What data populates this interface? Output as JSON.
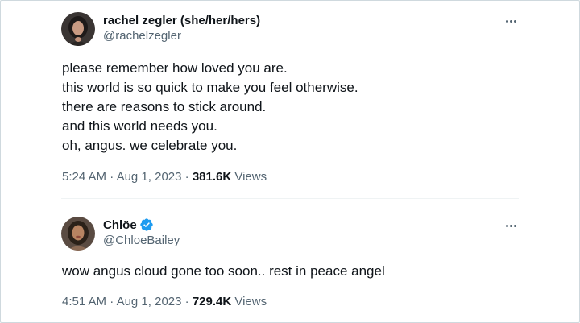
{
  "tweets": [
    {
      "display_name": "rachel zegler (she/her/hers)",
      "handle": "@rachelzegler",
      "verified": false,
      "lines": [
        "please remember how loved you are.",
        "this world is so quick to make you feel otherwise.",
        "there are reasons to stick around.",
        "and this world needs you.",
        "oh, angus. we celebrate you."
      ],
      "time": "5:24 AM",
      "date": "Aug 1, 2023",
      "views_count": "381.6K",
      "views_label": "Views"
    },
    {
      "display_name": "Chlöe",
      "handle": "@ChloeBailey",
      "verified": true,
      "lines": [
        "wow angus cloud gone too soon.. rest in peace angel"
      ],
      "time": "4:51 AM",
      "date": "Aug 1, 2023",
      "views_count": "729.4K",
      "views_label": "Views"
    }
  ],
  "separator": "·",
  "colors": {
    "text_primary": "#0f1419",
    "text_secondary": "#536471",
    "verified_blue": "#1d9bf0",
    "border": "#cfd9de"
  },
  "icons": {
    "more": "more-horizontal-icon",
    "verified": "verified-badge-icon"
  }
}
